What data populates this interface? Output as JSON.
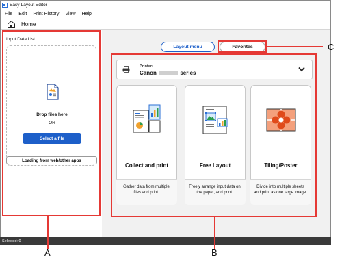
{
  "window": {
    "title": "Easy-Layout Editor"
  },
  "menu": [
    {
      "label": "File"
    },
    {
      "label": "Edit"
    },
    {
      "label": "Print History"
    },
    {
      "label": "View"
    },
    {
      "label": "Help"
    }
  ],
  "nav": {
    "home_label": "Home",
    "home_icon": "home-icon"
  },
  "input_panel": {
    "title": "Input Data List",
    "drop_text": "Drop files here",
    "or_text": "OR",
    "select_button": "Select a file",
    "web_button": "Loading from web/other apps"
  },
  "tabs": [
    {
      "label": "Layout menu",
      "active": true
    },
    {
      "label": "Favorites",
      "active": false
    }
  ],
  "printer": {
    "caption": "Printer:",
    "name_prefix": "Canon",
    "name_suffix": "series",
    "icon": "printer-icon"
  },
  "cards": [
    {
      "title": "Collect and print",
      "description": "Gather data from multiple files and print.",
      "icon": "collect-and-print-icon"
    },
    {
      "title": "Free Layout",
      "description": "Freely arrange input data on the paper, and print.",
      "icon": "free-layout-icon"
    },
    {
      "title": "Tiling/Poster",
      "description": "Divide into multiple sheets and print as one large image.",
      "icon": "tiling-poster-icon"
    }
  ],
  "status": {
    "text": "Selected: 0"
  },
  "annotations": {
    "a": "A",
    "b": "B",
    "c": "C"
  },
  "colors": {
    "accent": "#1d5fc9",
    "annotation_red": "#e53935",
    "status_bar": "#3a3a3a",
    "panel_bg": "#f1f1f1"
  }
}
